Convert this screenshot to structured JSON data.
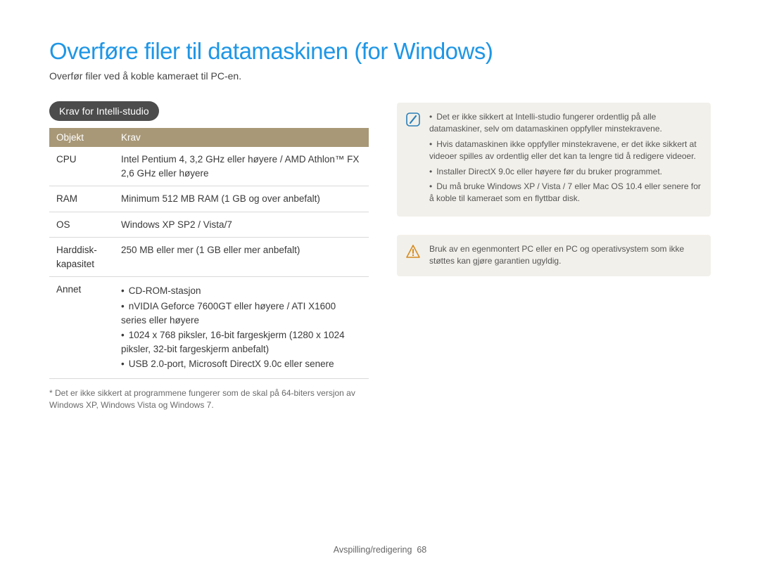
{
  "title": "Overføre filer til datamaskinen (for Windows)",
  "subtitle": "Overfør filer ved å koble kameraet til PC-en.",
  "section_heading": "Krav for Intelli-studio",
  "table": {
    "head": {
      "objekt": "Objekt",
      "krav": "Krav"
    },
    "rows": [
      {
        "objekt": "CPU",
        "krav": "Intel Pentium 4, 3,2 GHz eller høyere / AMD Athlon™ FX 2,6 GHz eller høyere"
      },
      {
        "objekt": "RAM",
        "krav": "Minimum 512 MB RAM (1 GB og over anbefalt)"
      },
      {
        "objekt": "OS",
        "krav": "Windows XP SP2 / Vista/7"
      },
      {
        "objekt": "Harddisk-kapasitet",
        "krav": "250 MB eller mer (1 GB eller mer anbefalt)"
      }
    ],
    "annet_label": "Annet",
    "annet_items": [
      "CD-ROM-stasjon",
      "nVIDIA Geforce 7600GT eller høyere / ATI X1600 series eller høyere",
      "1024 x 768 piksler, 16-bit fargeskjerm (1280 x 1024 piksler, 32-bit fargeskjerm anbefalt)",
      "USB 2.0-port, Microsoft DirectX 9.0c eller senere"
    ]
  },
  "footnote": "* Det er ikke sikkert at programmene fungerer som de skal på 64-biters versjon av Windows XP, Windows Vista og Windows 7.",
  "info_note_items": [
    "Det er ikke sikkert at Intelli-studio fungerer ordentlig på alle datamaskiner, selv om datamaskinen oppfyller minstekravene.",
    "Hvis datamaskinen ikke oppfyller minstekravene, er det ikke sikkert at videoer spilles av ordentlig eller det kan ta lengre tid å redigere videoer.",
    "Installer DirectX 9.0c eller høyere før du bruker programmet.",
    "Du må bruke Windows XP / Vista / 7 eller Mac OS 10.4 eller senere for å koble til kameraet som en flyttbar disk."
  ],
  "warn_note": "Bruk av en egenmontert PC eller en PC og operativsystem som ikke støttes kan gjøre garantien ugyldig.",
  "footer": {
    "section": "Avspilling/redigering",
    "page": "68"
  }
}
